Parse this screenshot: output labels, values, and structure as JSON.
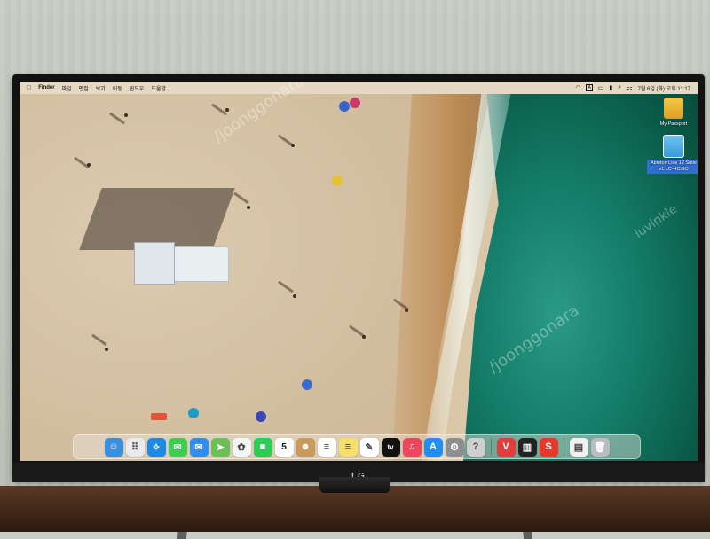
{
  "menubar": {
    "apple_glyph": "",
    "items": [
      "Finder",
      "파일",
      "편집",
      "보기",
      "이동",
      "윈도우",
      "도움말"
    ],
    "status_icons": [
      "wifi-icon",
      "text-input-a-icon",
      "display-icon",
      "battery-icon",
      "search-icon",
      "control-center-icon"
    ],
    "clock": "7월 6일 (화) 오후 11:17",
    "input_label": "A"
  },
  "desktop_icons": [
    {
      "label": "My Passport",
      "icon": "external-drive-icon",
      "color": "#f3c240"
    },
    {
      "label": "Ableton Live 12 Suite v1...C-HCiSO",
      "icon": "folder-icon",
      "color": "#4aa9e3"
    }
  ],
  "dock": {
    "apps": [
      {
        "name": "finder",
        "glyph": "☺",
        "color": "#3b8fe0"
      },
      {
        "name": "launchpad",
        "glyph": "⠿",
        "color": "#e9e9ee"
      },
      {
        "name": "safari",
        "glyph": "✧",
        "color": "#1e88e5"
      },
      {
        "name": "messages",
        "glyph": "✉",
        "color": "#3ccf4e"
      },
      {
        "name": "mail",
        "glyph": "✉",
        "color": "#2f8ef0"
      },
      {
        "name": "maps",
        "glyph": "➤",
        "color": "#6bbf59"
      },
      {
        "name": "photos",
        "glyph": "✿",
        "color": "#f5f5f5"
      },
      {
        "name": "facetime",
        "glyph": "■",
        "color": "#2ecc55"
      },
      {
        "name": "calendar",
        "glyph": "5",
        "color": "#ffffff"
      },
      {
        "name": "contacts",
        "glyph": "☻",
        "color": "#c99a5b"
      },
      {
        "name": "reminders",
        "glyph": "≡",
        "color": "#ffffff"
      },
      {
        "name": "notes",
        "glyph": "≡",
        "color": "#f7df6e"
      },
      {
        "name": "freeform",
        "glyph": "✎",
        "color": "#ffffff"
      },
      {
        "name": "apple-tv",
        "glyph": "tv",
        "color": "#111111"
      },
      {
        "name": "music",
        "glyph": "♫",
        "color": "#f0455e"
      },
      {
        "name": "app-store",
        "glyph": "A",
        "color": "#1f8ff0"
      },
      {
        "name": "system-settings",
        "glyph": "⚙",
        "color": "#8e8e93"
      },
      {
        "name": "tips",
        "glyph": "?",
        "color": "#cfcfcf"
      },
      {
        "name": "vivaldi",
        "glyph": "V",
        "color": "#e23d3d"
      },
      {
        "name": "piano",
        "glyph": "▥",
        "color": "#222222"
      },
      {
        "name": "scrivener",
        "glyph": "S",
        "color": "#e6392b"
      },
      {
        "name": "document",
        "glyph": "▤",
        "color": "#f0f0f0"
      },
      {
        "name": "trash",
        "glyph": "🗑",
        "color": "#b9bcc0"
      }
    ]
  },
  "monitor": {
    "brand": "LG"
  },
  "watermarks": [
    "luvinkle",
    "/joonggonara",
    "/joonggonara"
  ]
}
